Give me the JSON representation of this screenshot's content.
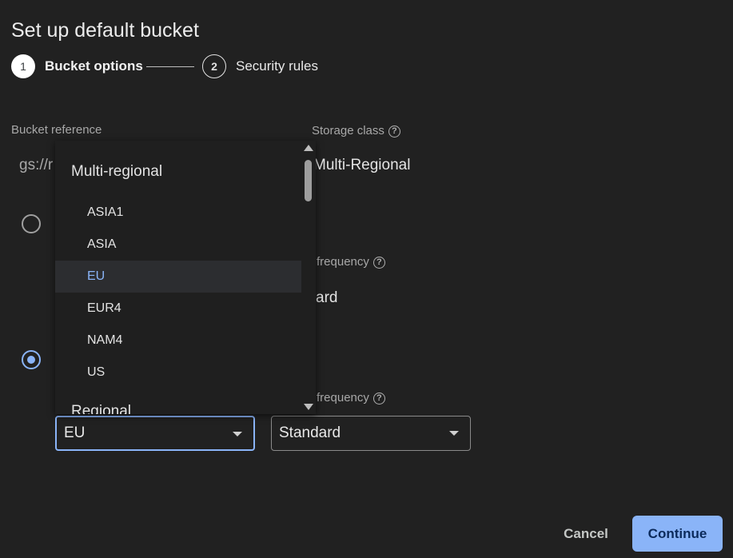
{
  "dialog": {
    "title": "Set up default bucket"
  },
  "stepper": {
    "steps": [
      {
        "number": "1",
        "label": "Bucket options"
      },
      {
        "number": "2",
        "label": "Security rules"
      }
    ]
  },
  "bucket_reference": {
    "label": "Bucket reference",
    "value_visible": "gs://r"
  },
  "storage_class": {
    "label": "Storage class",
    "value": "Multi-Regional"
  },
  "access_frequency_1": {
    "label_visible": "frequency",
    "value_visible": "ard"
  },
  "access_frequency_2": {
    "label_visible": "frequency"
  },
  "location_options": [
    {
      "selected": false
    },
    {
      "selected": true
    }
  ],
  "location_select": {
    "value": "EU"
  },
  "frequency_select": {
    "value": "Standard"
  },
  "dropdown": {
    "group_multi": "Multi-regional",
    "items": [
      "ASIA1",
      "ASIA",
      "EU",
      "EUR4",
      "NAM4",
      "US"
    ],
    "selected": "EU",
    "group_regional": "Regional"
  },
  "help_icon_glyph": "?",
  "buttons": {
    "cancel": "Cancel",
    "continue": "Continue"
  },
  "colors": {
    "accent": "#8ab4f8",
    "background": "#212121"
  }
}
